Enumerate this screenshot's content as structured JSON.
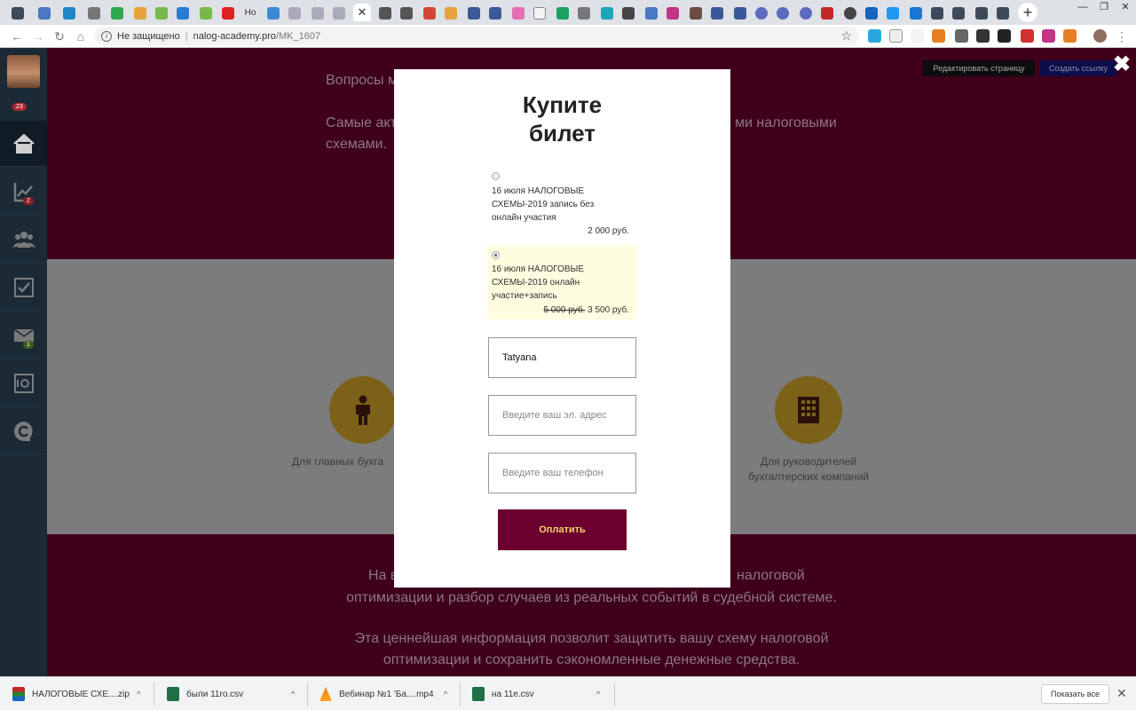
{
  "browser": {
    "tab_close": "✕",
    "newtab": "+",
    "omnibox": {
      "security": "Не защищено",
      "separator": "|",
      "host": "nalog-academy.pro",
      "path": "/MK_1607",
      "star": "☆"
    },
    "tab_partial_label": "Но",
    "window_controls": [
      "—",
      "❐",
      "✕"
    ]
  },
  "sidebar": {
    "avatar_badge": "23",
    "badges": {
      "stats": "2",
      "mail": "1"
    },
    "icons": [
      "home-icon",
      "chart-icon",
      "users-icon",
      "checkbox-icon",
      "mail-icon",
      "safe-icon",
      "logo-icon"
    ]
  },
  "admin": {
    "edit_page": "Редактировать страницу",
    "create_link": "Создать ссылку",
    "close": "✖"
  },
  "hero": {
    "line1": "Вопросы м",
    "line2_left": "Самые акти",
    "line2_right": "ми налоговыми",
    "line3": "схемами."
  },
  "audience": {
    "left_label": "Для главных бухга",
    "right_label_1": "Для руководителей",
    "right_label_2": "бухгалтерских компаний"
  },
  "footer": {
    "line1_left": "На в",
    "line1_right": "налоговой",
    "line2": "оптимизации и разбор случаев из реальных событий в судебной системе.",
    "line3": "Эта ценнейшая информация позволит защитить вашу схему налоговой",
    "line4": "оптимизации и сохранить сэкономленные денежные средства."
  },
  "modal": {
    "title_line1": "Купите",
    "title_line2": "билет",
    "options": [
      {
        "label": "16 июля НАЛОГОВЫЕ СХЕМЫ-2019 запись без онлайн участия",
        "price": "2 000 руб.",
        "old_price": "",
        "selected": false
      },
      {
        "label": "16 июля НАЛОГОВЫЕ СХЕМЫ-2019 онлайн участие+запись",
        "price": "3 500 руб.",
        "old_price": "5 000 руб.",
        "selected": true
      }
    ],
    "name_value": "Tatyana",
    "email_placeholder": "Введите ваш эл. адрес",
    "phone_placeholder": "Введите ваш телефон",
    "pay_button": "Оплатить"
  },
  "downloads": {
    "items": [
      {
        "name": "НАЛОГОВЫЕ СХЕ....zip",
        "icon": "zip-icon"
      },
      {
        "name": "были 11ro.csv",
        "icon": "csv-icon"
      },
      {
        "name": "Вебинар №1 'Ба....mp4",
        "icon": "vlc-icon"
      },
      {
        "name": "на 11e.csv",
        "icon": "csv-icon"
      }
    ],
    "chevron": "^",
    "show_all": "Показать все",
    "close": "✕"
  }
}
